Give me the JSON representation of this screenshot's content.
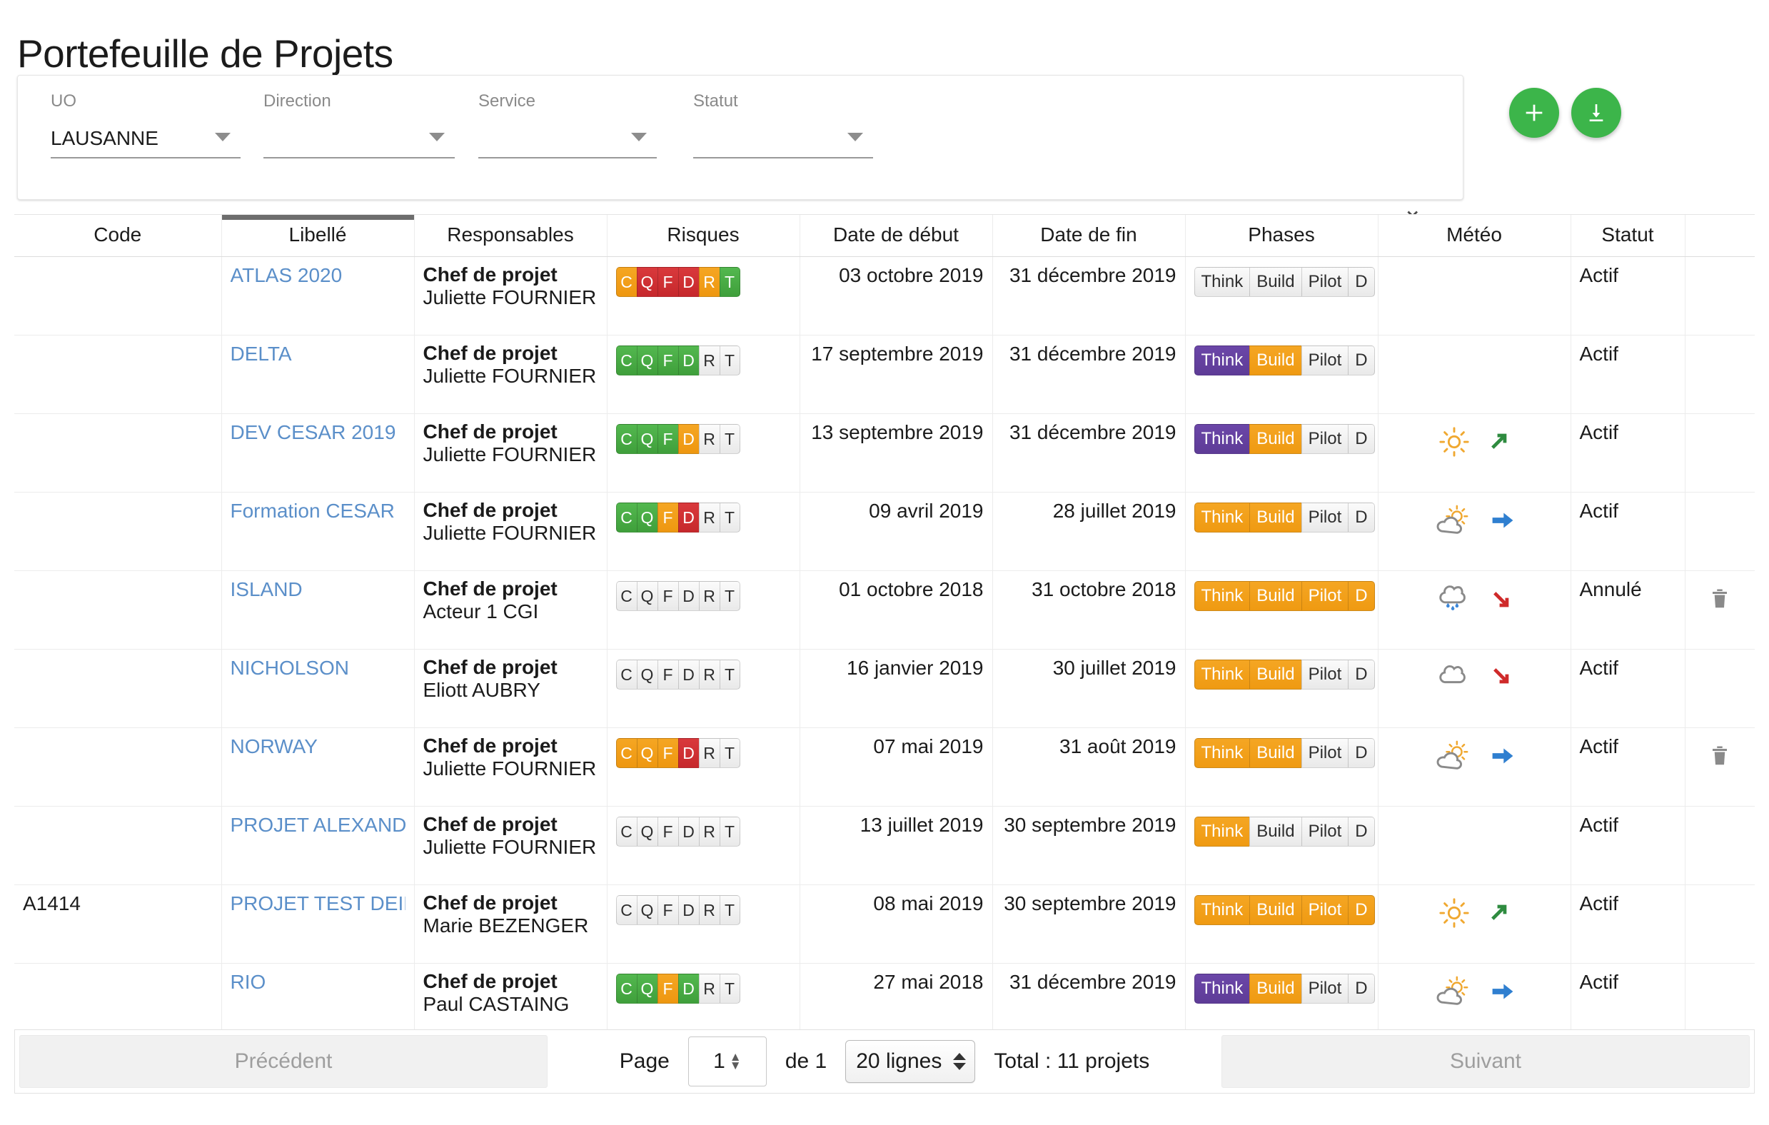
{
  "header": {
    "title": "Portefeuille de Projets"
  },
  "filters": {
    "fields": [
      {
        "label": "UO",
        "value": "LAUSANNE"
      },
      {
        "label": "Direction",
        "value": ""
      },
      {
        "label": "Service",
        "value": ""
      },
      {
        "label": "Statut",
        "value": ""
      }
    ],
    "expand_icon": "chevron-down-icon"
  },
  "actions": [
    {
      "name": "add-project-button",
      "icon": "plus-icon",
      "color": "#3cb54a"
    },
    {
      "name": "export-button",
      "icon": "download-icon",
      "color": "#3cb54a"
    }
  ],
  "table": {
    "columns": [
      {
        "key": "code",
        "label": "Code",
        "sorted": false
      },
      {
        "key": "lib",
        "label": "Libellé",
        "sorted": true
      },
      {
        "key": "resp",
        "label": "Responsables",
        "sorted": false
      },
      {
        "key": "risk",
        "label": "Risques",
        "sorted": false
      },
      {
        "key": "start",
        "label": "Date de début",
        "sorted": false
      },
      {
        "key": "end",
        "label": "Date de fin",
        "sorted": false
      },
      {
        "key": "phase",
        "label": "Phases",
        "sorted": false
      },
      {
        "key": "meteo",
        "label": "Météo",
        "sorted": false
      },
      {
        "key": "statut",
        "label": "Statut",
        "sorted": false
      },
      {
        "key": "act",
        "label": "",
        "sorted": false
      }
    ],
    "risk_keys": [
      "C",
      "Q",
      "F",
      "D",
      "R",
      "T"
    ],
    "phase_labels": [
      "Think",
      "Build",
      "Pilot",
      "D"
    ],
    "rows": [
      {
        "code": "",
        "libelle": "ATLAS 2020",
        "role": "Chef de projet",
        "responsable": "Juliette FOURNIER",
        "risks": [
          "o",
          "r",
          "r",
          "r",
          "o",
          "g"
        ],
        "start": "03 octobre 2019",
        "end": "31 décembre 2019",
        "phases": [
          "none",
          "none",
          "none",
          "none"
        ],
        "meteo": "",
        "trend": "",
        "statut": "Actif",
        "deletable": false
      },
      {
        "code": "",
        "libelle": "DELTA",
        "role": "Chef de projet",
        "responsable": "Juliette FOURNIER",
        "risks": [
          "g",
          "g",
          "g",
          "g",
          "none",
          "none"
        ],
        "start": "17 septembre 2019",
        "end": "31 décembre 2019",
        "phases": [
          "purple",
          "orange",
          "none",
          "none"
        ],
        "meteo": "",
        "trend": "",
        "statut": "Actif",
        "deletable": false
      },
      {
        "code": "",
        "libelle": "DEV CESAR 2019",
        "role": "Chef de projet",
        "responsable": "Juliette FOURNIER",
        "risks": [
          "g",
          "g",
          "g",
          "o",
          "none",
          "none"
        ],
        "start": "13 septembre 2019",
        "end": "31 décembre 2019",
        "phases": [
          "purple",
          "orange",
          "none",
          "none"
        ],
        "meteo": "sun",
        "trend": "up",
        "statut": "Actif",
        "deletable": false
      },
      {
        "code": "",
        "libelle": "Formation CESAR",
        "role": "Chef de projet",
        "responsable": "Juliette FOURNIER",
        "risks": [
          "g",
          "g",
          "o",
          "r",
          "none",
          "none"
        ],
        "start": "09 avril 2019",
        "end": "28 juillet 2019",
        "phases": [
          "orange",
          "orange",
          "none",
          "none"
        ],
        "meteo": "sun-cloud",
        "trend": "flat",
        "statut": "Actif",
        "deletable": false
      },
      {
        "code": "",
        "libelle": "ISLAND",
        "role": "Chef de projet",
        "responsable": "Acteur 1 CGI",
        "risks": [
          "none",
          "none",
          "none",
          "none",
          "none",
          "none"
        ],
        "start": "01 octobre 2018",
        "end": "31 octobre 2018",
        "phases": [
          "orange",
          "orange",
          "orange",
          "orange"
        ],
        "meteo": "rain",
        "trend": "down",
        "statut": "Annulé",
        "deletable": true
      },
      {
        "code": "",
        "libelle": "NICHOLSON",
        "role": "Chef de projet",
        "responsable": "Eliott AUBRY",
        "risks": [
          "none",
          "none",
          "none",
          "none",
          "none",
          "none"
        ],
        "start": "16 janvier 2019",
        "end": "30 juillet 2019",
        "phases": [
          "orange",
          "orange",
          "none",
          "none"
        ],
        "meteo": "cloud",
        "trend": "down",
        "statut": "Actif",
        "deletable": false
      },
      {
        "code": "",
        "libelle": "NORWAY",
        "role": "Chef de projet",
        "responsable": "Juliette FOURNIER",
        "risks": [
          "o",
          "o",
          "o",
          "r",
          "none",
          "none"
        ],
        "start": "07 mai 2019",
        "end": "31 août 2019",
        "phases": [
          "orange",
          "orange",
          "none",
          "none"
        ],
        "meteo": "sun-cloud",
        "trend": "flat",
        "statut": "Actif",
        "deletable": true
      },
      {
        "code": "",
        "libelle": "PROJET ALEXANDRE",
        "role": "Chef de projet",
        "responsable": "Juliette FOURNIER",
        "risks": [
          "none",
          "none",
          "none",
          "none",
          "none",
          "none"
        ],
        "start": "13 juillet 2019",
        "end": "30 septembre 2019",
        "phases": [
          "orange",
          "none",
          "none",
          "none"
        ],
        "meteo": "",
        "trend": "",
        "statut": "Actif",
        "deletable": false
      },
      {
        "code": "A1414",
        "libelle": "PROJET TEST DEIN",
        "role": "Chef de projet",
        "responsable": "Marie BEZENGER",
        "risks": [
          "none",
          "none",
          "none",
          "none",
          "none",
          "none"
        ],
        "start": "08 mai 2019",
        "end": "30 septembre 2019",
        "phases": [
          "orange",
          "orange",
          "orange",
          "orange"
        ],
        "meteo": "sun",
        "trend": "up",
        "statut": "Actif",
        "deletable": false
      },
      {
        "code": "",
        "libelle": "RIO",
        "role": "Chef de projet",
        "responsable": "Paul CASTAING",
        "risks": [
          "g",
          "g",
          "o",
          "g",
          "none",
          "none"
        ],
        "start": "27 mai 2018",
        "end": "31 décembre 2019",
        "phases": [
          "purple",
          "orange",
          "none",
          "none"
        ],
        "meteo": "sun-cloud",
        "trend": "flat",
        "statut": "Actif",
        "deletable": false
      }
    ]
  },
  "footer": {
    "prev_label": "Précédent",
    "next_label": "Suivant",
    "page_label": "Page",
    "page_value": "1",
    "of_label": "de 1",
    "rows_per_page": "20 lignes",
    "total": "Total : 11 projets"
  }
}
